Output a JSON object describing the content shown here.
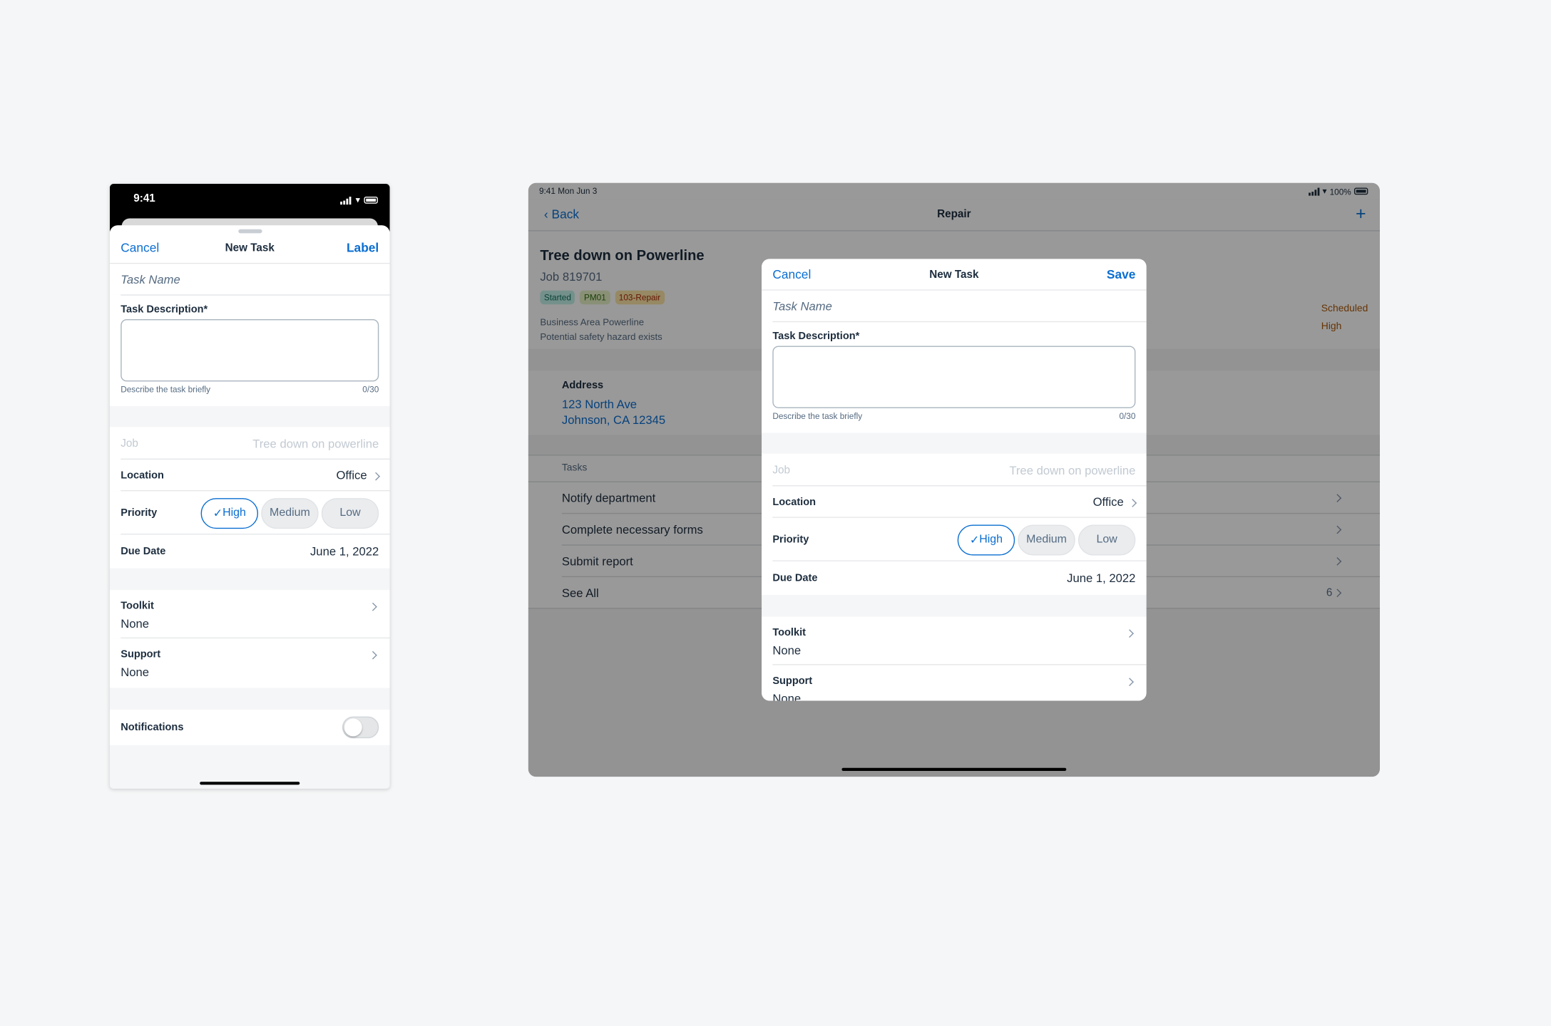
{
  "colors": {
    "accent": "#0a6ed1",
    "critical": "#aa5808",
    "background": "#f5f6f7"
  },
  "phone": {
    "status": {
      "time": "9:41",
      "icons": [
        "cellular-signal-icon",
        "wifi-icon",
        "battery-icon"
      ]
    },
    "nav": {
      "cancel": "Cancel",
      "title": "New Task",
      "action": "Label"
    },
    "form": {
      "task_name_placeholder": "Task Name",
      "description_label": "Task Description*",
      "description_value": "",
      "description_helper": "Describe the task briefly",
      "description_counter": "0/30",
      "job_label": "Job",
      "job_value": "Tree down on powerline",
      "location_label": "Location",
      "location_value": "Office",
      "priority_label": "Priority",
      "priority_options": [
        "High",
        "Medium",
        "Low"
      ],
      "priority_selected": "High",
      "due_label": "Due Date",
      "due_value": "June 1, 2022",
      "toolkit_label": "Toolkit",
      "toolkit_value": "None",
      "support_label": "Support",
      "support_value": "None",
      "notifications_label": "Notifications",
      "notifications_on": false
    }
  },
  "tablet": {
    "status": {
      "time": "9:41  Mon Jun 3",
      "battery": "100%"
    },
    "nav": {
      "back": "Back",
      "title": "Repair",
      "add_icon": "plus-icon"
    },
    "header": {
      "title": "Tree down on Powerline",
      "job": "Job 819701",
      "tags": [
        {
          "label": "Started",
          "bg": "#c2f1e8",
          "fg": "#0e6e5c"
        },
        {
          "label": "PM01",
          "bg": "#e5f0c5",
          "fg": "#2f6b0f"
        },
        {
          "label": "103-Repair",
          "bg": "#fbe4a6",
          "fg": "#aa2608"
        }
      ],
      "line1": "Business Area Powerline",
      "line2": "Potential safety hazard exists",
      "status": "Scheduled",
      "priority": "High"
    },
    "address": {
      "label": "Address",
      "line1": "123 North Ave",
      "line2": "Johnson, CA 12345"
    },
    "tasks": {
      "header": "Tasks",
      "items": [
        "Notify department",
        "Complete necessary forms",
        "Submit report"
      ],
      "see_all": "See All",
      "count": "6"
    },
    "modal": {
      "nav": {
        "cancel": "Cancel",
        "title": "New Task",
        "action": "Save"
      },
      "form": {
        "task_name_placeholder": "Task Name",
        "description_label": "Task Description*",
        "description_helper": "Describe the task briefly",
        "description_counter": "0/30",
        "job_label": "Job",
        "job_value": "Tree down on powerline",
        "location_label": "Location",
        "location_value": "Office",
        "priority_label": "Priority",
        "priority_options": [
          "High",
          "Medium",
          "Low"
        ],
        "priority_selected": "High",
        "due_label": "Due Date",
        "due_value": "June 1, 2022",
        "toolkit_label": "Toolkit",
        "toolkit_value": "None",
        "support_label": "Support",
        "support_value": "None"
      }
    }
  }
}
